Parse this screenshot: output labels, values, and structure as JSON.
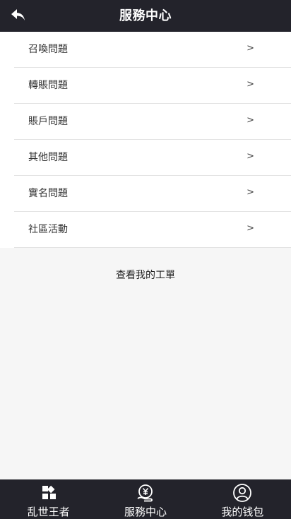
{
  "header": {
    "title": "服務中心"
  },
  "menu": [
    {
      "label": "召喚問題",
      "arrow": ">"
    },
    {
      "label": "轉賬問題",
      "arrow": ">"
    },
    {
      "label": "賬戶問題",
      "arrow": ">"
    },
    {
      "label": "其他問題",
      "arrow": ">"
    },
    {
      "label": "實名問題",
      "arrow": ">"
    },
    {
      "label": "社區活動",
      "arrow": ">"
    }
  ],
  "ticket_link": "查看我的工單",
  "tabbar": [
    {
      "label": "乱世王者",
      "icon": "grid-icon"
    },
    {
      "label": "服務中心",
      "icon": "yen-hand-icon"
    },
    {
      "label": "我的钱包",
      "icon": "user-circle-icon"
    }
  ],
  "colors": {
    "header_bg": "#23232b",
    "page_bg": "#f6f6f6",
    "menu_bg": "#ffffff",
    "divider": "#e3e3e3"
  }
}
